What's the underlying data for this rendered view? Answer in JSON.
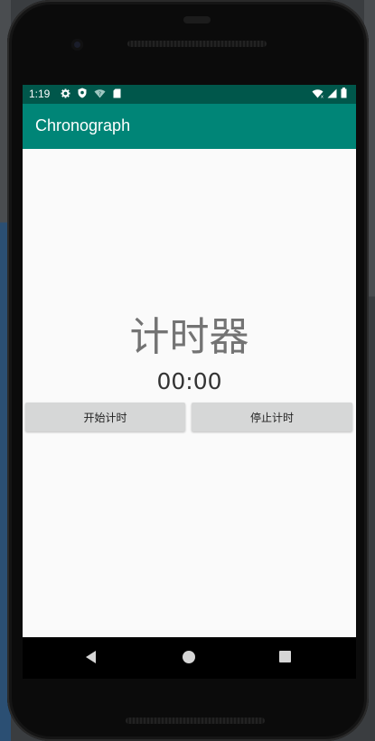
{
  "status_bar": {
    "time": "1:19",
    "icons": [
      "settings-gear-icon",
      "shield-icon",
      "wifi-question-icon",
      "sd-card-icon",
      "wifi-icon",
      "cell-signal-icon",
      "battery-icon"
    ]
  },
  "app_bar": {
    "title": "Chronograph"
  },
  "main": {
    "heading": "计时器",
    "timer": "00:00",
    "start_button": "开始计时",
    "stop_button": "停止计时"
  },
  "nav_bar": {
    "buttons": [
      "back-icon",
      "home-icon",
      "recents-icon"
    ]
  },
  "colors": {
    "status_bar": "#00574b",
    "app_bar": "#008577",
    "background": "#fafafa",
    "button": "#d6d7d7"
  }
}
